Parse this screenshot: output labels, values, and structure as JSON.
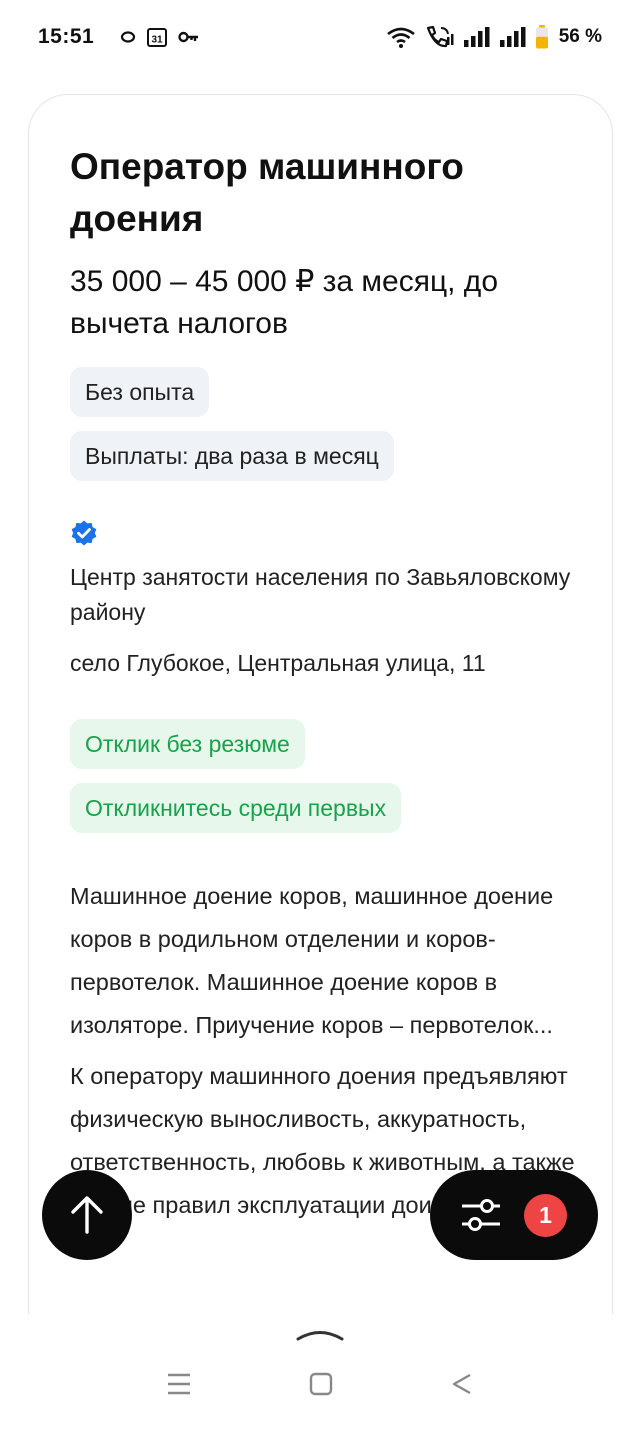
{
  "status_bar": {
    "time": "15:51",
    "battery_percent": "56 %",
    "icons": [
      "ring-icon",
      "calendar-icon",
      "key-icon",
      "wifi-icon",
      "wifi-calling-icon",
      "signal-icon",
      "signal-icon",
      "battery-icon"
    ],
    "calendar_day": "31",
    "battery_level": 0.56,
    "battery_color": "#f5b400"
  },
  "vacancy": {
    "title": "Оператор машинного доения",
    "salary": "35 000 – 45 000 ₽ за месяц, до вычета налогов",
    "tags": [
      "Без опыта",
      "Выплаты: два раза в месяц"
    ],
    "verified_icon": "verified-badge-icon",
    "company": "Центр занятости населения по Завьяловскому району",
    "address": "село Глубокое, Центральная улица, 11",
    "response_tags": [
      "Отклик без резюме",
      "Откликнитесь среди первых"
    ],
    "description": "Машинное доение коров, машинное доение коров в родильном отделении и коров-первотелок. Машинное доение коров в изоляторе. Приучение коров – первотелок...",
    "requirements": "К оператору машинного доения предъявляют физическую выносливость, аккуратность, ответственность, любовь к животным, а также знание правил эксплуатации доильного"
  },
  "fab": {
    "scroll_up_icon": "arrow-up-icon",
    "filter_icon": "sliders-icon",
    "filter_count": "1"
  },
  "colors": {
    "accent_green": "#16a34a",
    "chip_gray": "#eff2f6",
    "chip_green_bg": "#e8f7ec",
    "badge_red": "#ef4444",
    "verified_blue": "#1a73e8"
  },
  "nav_bar": {
    "icons": [
      "menu-icon",
      "home-square-icon",
      "back-triangle-icon"
    ]
  }
}
